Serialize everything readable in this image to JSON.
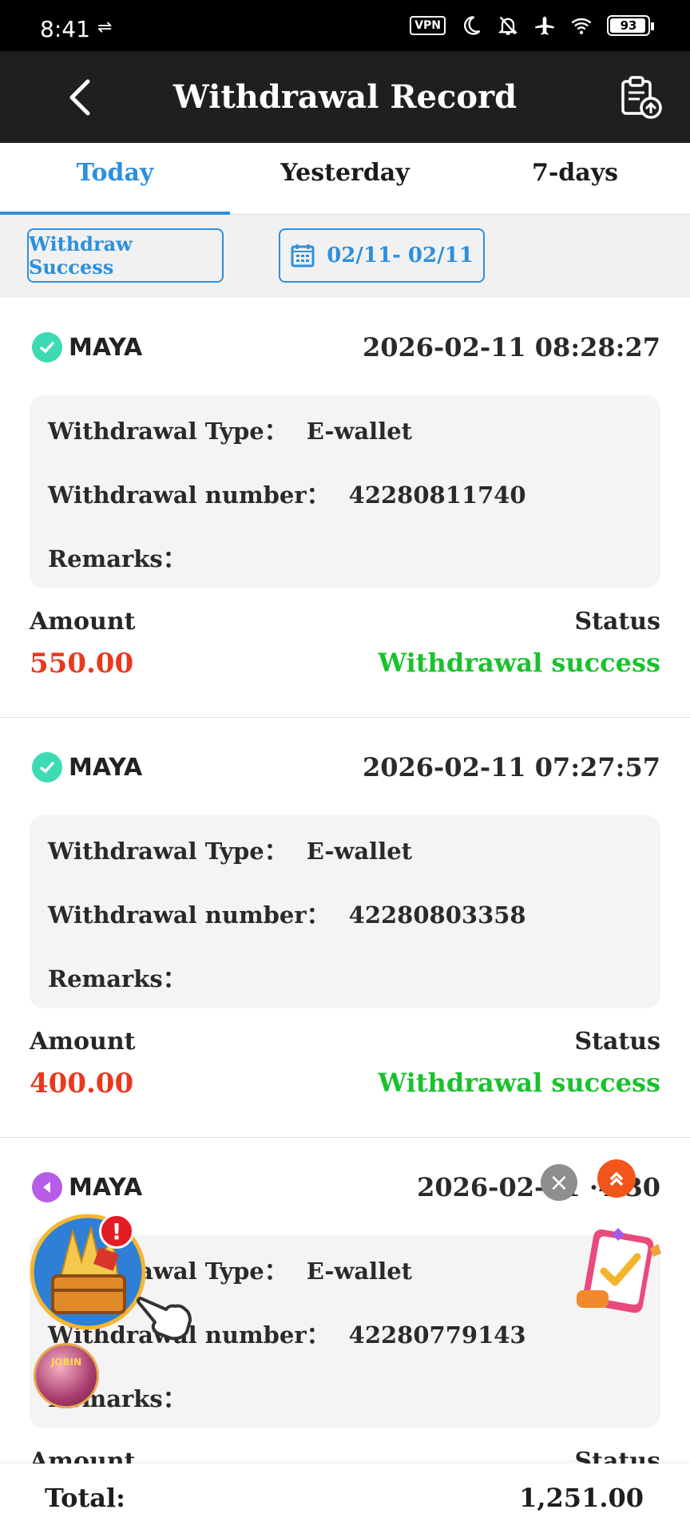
{
  "status_bar": {
    "time": "8:41",
    "vpn": "VPN",
    "battery": "93"
  },
  "header": {
    "title": "Withdrawal Record"
  },
  "tabs": [
    {
      "label": "Today",
      "active": true
    },
    {
      "label": "Yesterday",
      "active": false
    },
    {
      "label": "7-days",
      "active": false
    }
  ],
  "filters": {
    "status": "Withdraw Success",
    "date_range": "02/11- 02/11"
  },
  "labels": {
    "withdrawal_type": "Withdrawal Type：",
    "withdrawal_number": "Withdrawal number：",
    "remarks": "Remarks：",
    "amount": "Amount",
    "status": "Status"
  },
  "records": [
    {
      "provider": "MAYA",
      "datetime": "2026-02-11 08:28:27",
      "type": "E-wallet",
      "number": "42280811740",
      "remarks": "",
      "amount": "550.00",
      "status": "Withdrawal success"
    },
    {
      "provider": "MAYA",
      "datetime": "2026-02-11 07:27:57",
      "type": "E-wallet",
      "number": "42280803358",
      "remarks": "",
      "amount": "400.00",
      "status": "Withdrawal success"
    },
    {
      "provider": "MAYA",
      "datetime": "2026-02-11 ·4·30",
      "type": "E-wallet",
      "number": "42280779143",
      "remarks": "",
      "amount": "",
      "status": ""
    }
  ],
  "total": {
    "label": "Total:",
    "value": "1,251.00"
  },
  "colors": {
    "accent": "#2d8fdd",
    "amount": "#e8391f",
    "success": "#19c22d",
    "header_bg": "#1f1f1f"
  }
}
